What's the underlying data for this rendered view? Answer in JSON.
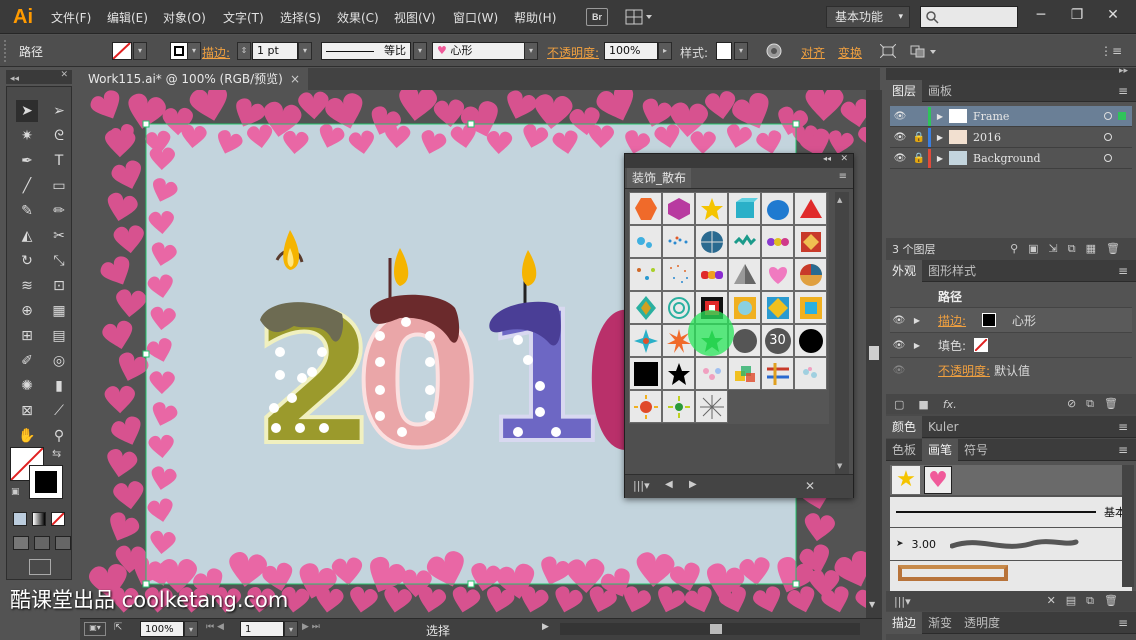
{
  "app": {
    "logo": "Ai",
    "bridge": "Br",
    "workspace": "基本功能",
    "workspace_arrow": "▾"
  },
  "menu": [
    "文件(F)",
    "编辑(E)",
    "对象(O)",
    "文字(T)",
    "选择(S)",
    "效果(C)",
    "视图(V)",
    "窗口(W)",
    "帮助(H)"
  ],
  "window_controls": {
    "minimize": "─",
    "restore": "❐",
    "close": "✕"
  },
  "control_bar": {
    "object_type": "路径",
    "stroke_label": "描边:",
    "stroke_weight": "1 pt",
    "stroke_profile": "等比",
    "brush": "心形",
    "opacity_label": "不透明度:",
    "opacity_value": "100%",
    "style_label": "样式:",
    "align_label": "对齐",
    "transform_label": "变换"
  },
  "document": {
    "tab_title": "Work115.ai* @ 100% (RGB/预览)",
    "tab_close": "×"
  },
  "artwork": {
    "digits": [
      "2",
      "0",
      "1"
    ]
  },
  "float_panel": {
    "title": "装饰_散布",
    "symbol_30": "30"
  },
  "layers_panel": {
    "tabs": [
      "图层",
      "画板"
    ],
    "layers": [
      {
        "name": "Frame",
        "color": "#2fc45a",
        "selected": true
      },
      {
        "name": "2016",
        "color": "#3a7fe0",
        "selected": false
      },
      {
        "name": "Background",
        "color": "#e04a3a",
        "selected": false
      }
    ],
    "count_label": "3 个图层"
  },
  "appearance_panel": {
    "tabs": [
      "外观",
      "图形样式"
    ],
    "title": "路径",
    "stroke_label": "描边:",
    "stroke_value": "心形",
    "fill_label": "填色:",
    "opacity_label": "不透明度:",
    "opacity_value": "默认值",
    "fx": "fx."
  },
  "color_panel": {
    "tabs": [
      "颜色",
      "Kuler"
    ]
  },
  "brush_panel": {
    "tabs": [
      "色板",
      "画笔",
      "符号"
    ],
    "basic_label": "基本",
    "brush_size": "3.00"
  },
  "bottom_tabs": [
    "描边",
    "渐变",
    "透明度"
  ],
  "status": {
    "zoom": "100%",
    "artboard": "1",
    "tool": "选择"
  },
  "watermark": "酷课堂出品 coolketang.com",
  "colors": {
    "accent": "#ff9a00",
    "heart": "#f05a9a",
    "artboard": "#c3d4dd",
    "selection": "#23c36b"
  }
}
